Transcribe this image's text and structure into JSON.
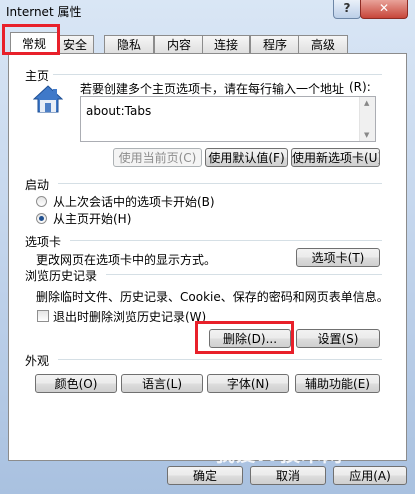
{
  "window": {
    "title": "Internet 属性",
    "help_label": "?",
    "close_label": "✕"
  },
  "tabs": [
    "常规",
    "安全",
    "隐私",
    "内容",
    "连接",
    "程序",
    "高级"
  ],
  "homepage": {
    "group_label": "主页",
    "desc": "若要创建多个主页选项卡，请在每行输入一个地址",
    "desc_key": "(R):",
    "value": "about:Tabs",
    "buttons": [
      "使用当前页(C)",
      "使用默认值(F)",
      "使用新选项卡(U)"
    ]
  },
  "startup": {
    "group_label": "启动",
    "options": [
      "从上次会话中的选项卡开始(B)",
      "从主页开始(H)"
    ],
    "selected": 1
  },
  "tabs_group": {
    "group_label": "选项卡",
    "desc": "更改网页在选项卡中的显示方式。",
    "button": "选项卡(T)"
  },
  "history": {
    "group_label": "浏览历史记录",
    "desc": "删除临时文件、历史记录、Cookie、保存的密码和网页表单信息。",
    "checkbox": "退出时删除浏览历史记录(W)",
    "checked": false,
    "delete_button": "删除(D)...",
    "settings_button": "设置(S)"
  },
  "appearance": {
    "group_label": "外观",
    "buttons": [
      "颜色(O)",
      "语言(L)",
      "字体(N)",
      "辅助功能(E)"
    ]
  },
  "footer": {
    "ok": "确定",
    "cancel": "取消",
    "apply": "应用(A)"
  },
  "watermark": "我爱IT技术网"
}
